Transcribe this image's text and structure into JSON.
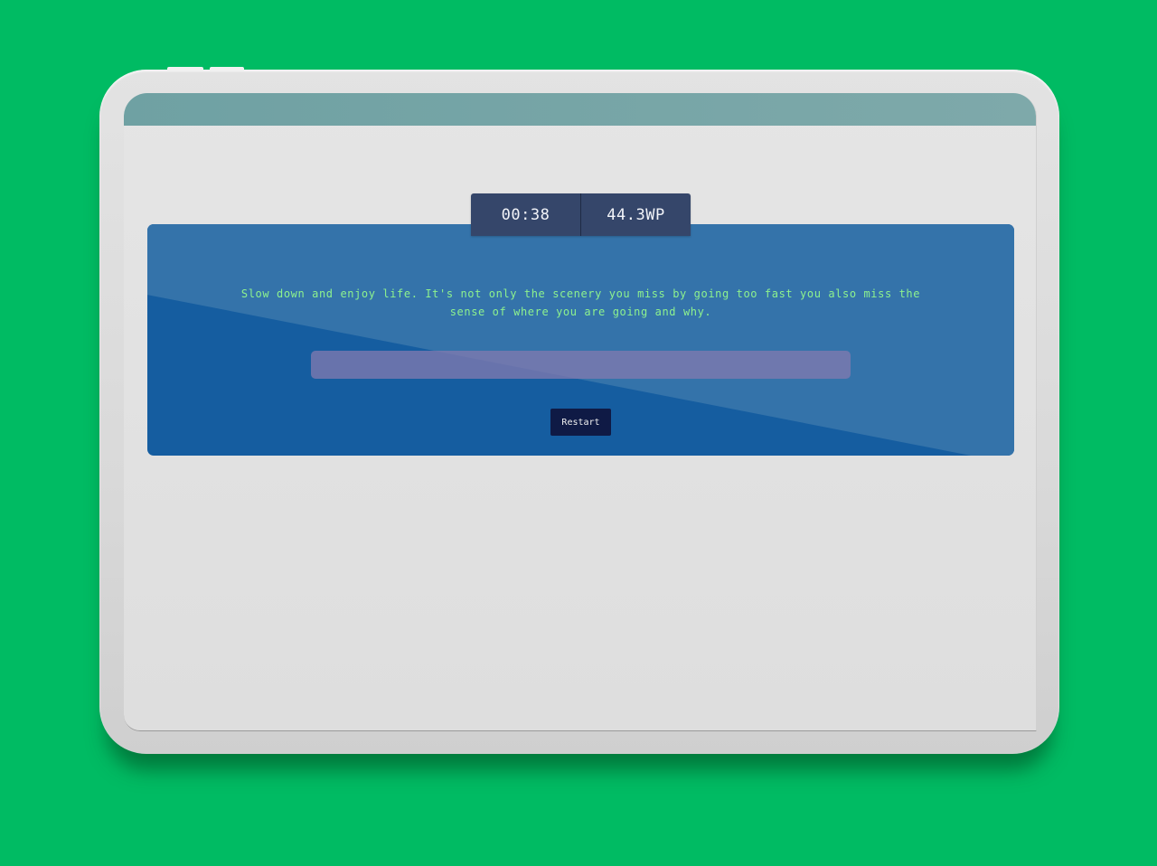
{
  "stats": {
    "timer": "00:38",
    "speed": "44.3WP"
  },
  "quote": {
    "text": "Slow down and enjoy life. It's not only the scenery you miss by going too fast you also miss the sense of where you are going and why."
  },
  "typing_input": {
    "value": "",
    "placeholder": ""
  },
  "restart_button": {
    "label": "Restart"
  },
  "colors": {
    "background": "#00bb63",
    "screen_topbar": "#76a5a6",
    "stats_badge": "#35466a",
    "card_dark": "#155da0",
    "card_light": "#3473aa",
    "quote_text": "#8ef28e",
    "input_bg": "#807aaf",
    "restart_button": "#0f1a45"
  }
}
